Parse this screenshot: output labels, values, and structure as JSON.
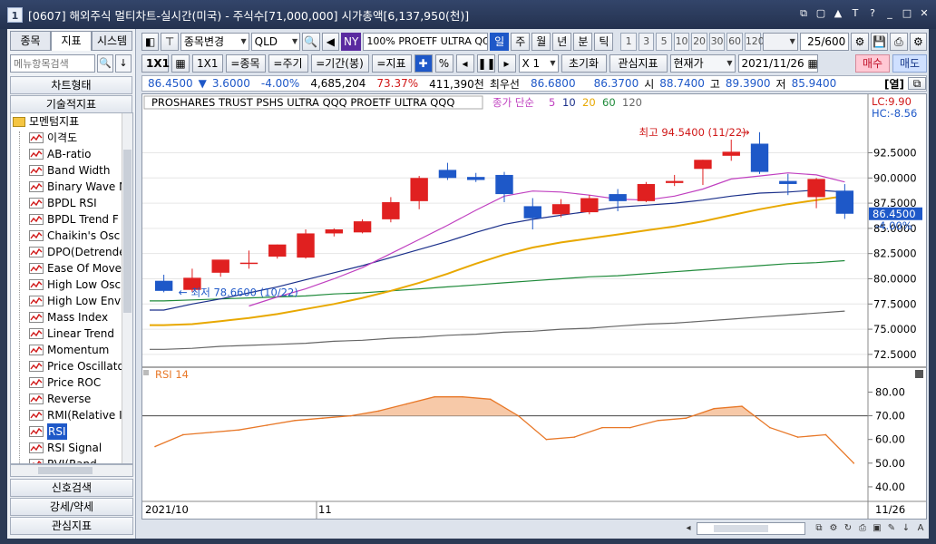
{
  "window": {
    "title": "[0607] 해외주식 멀티차트-실시간(미국) - 주식수[71,000,000] 시가총액[6,137,950(천)]",
    "app_icon_label": "1",
    "buttons": [
      "⧉",
      "▢",
      "▲",
      "T",
      "?",
      "_",
      "□",
      "✕"
    ]
  },
  "left_panel": {
    "tabs": [
      "종목",
      "지표",
      "시스템"
    ],
    "active_tab": "지표",
    "search_placeholder": "메뉴항목검색",
    "sections_top": [
      "차트형태",
      "기술적지표"
    ],
    "folder": "모멘텀지표",
    "items": [
      "이격도",
      "AB-ratio",
      "Band Width",
      "Binary Wave N",
      "BPDL RSI",
      "BPDL Trend F",
      "Chaikin's Osc",
      "DPO(Detrende",
      "Ease Of Move",
      "High Low Osc",
      "High Low Env",
      "Mass Index",
      "Linear Trend",
      "Momentum",
      "Price Oscillato",
      "Price ROC",
      "Reverse",
      "RMI(Relative I",
      "RSI",
      "RSI Signal",
      "RVI(Rand"
    ],
    "selected_item": "RSI",
    "sections_bottom": [
      "신호검색",
      "강세/약세",
      "관심지표"
    ]
  },
  "toolbar1": {
    "symbol_change": "종목변경",
    "ticker": "QLD",
    "market_badge": "NY",
    "zoom": "100%",
    "name": "PROETF ULTRA QQQ",
    "periods": [
      "일",
      "주",
      "월",
      "년",
      "분",
      "틱"
    ],
    "active_period": "일",
    "intervals": [
      "1",
      "3",
      "5",
      "10",
      "20",
      "30",
      "60",
      "120"
    ],
    "count": "25",
    "count_total": "/600"
  },
  "toolbar2": {
    "ratio": "1X1",
    "ratio2": "1X1",
    "btn_symbol": "=종목",
    "btn_period": "=주기",
    "btn_range": "=기간(봉)",
    "btn_indicator": "=지표",
    "multiplier": "X 1",
    "reset": "초기화",
    "fav_indicator": "관심지표",
    "price_mode": "현재가",
    "date": "2021/11/26",
    "buy": "매수",
    "sell": "매도"
  },
  "quote": {
    "price": "86.4500",
    "change_arrow": "▼",
    "change": "3.6000",
    "change_pct": "-4.00%",
    "volume": "4,685,204",
    "vol_ratio": "73.37%",
    "amount": "411,390천",
    "best_bid_label": "최우선",
    "bid": "86.6800",
    "ask": "86.3700",
    "open_label": "시",
    "open": "88.7400",
    "high_label": "고",
    "high": "89.3900",
    "low_label": "저",
    "low": "85.9400",
    "view_label": "[열]"
  },
  "chart_data": [
    {
      "type": "candlestick",
      "title": "PROSHARES TRUST PSHS ULTRA QQQ  PROETF ULTRA QQQ",
      "legend_label": "종가 단순",
      "ma_periods": [
        "5",
        "10",
        "20",
        "60",
        "120"
      ],
      "ma_colors": [
        "#c040c0",
        "#1a2f8a",
        "#e8a800",
        "#1f8a3a",
        "#666666"
      ],
      "up_color": "#e02020",
      "down_color": "#1e58c8",
      "candles": [
        {
          "o": 79.8,
          "h": 80.4,
          "l": 78.66,
          "c": 78.8
        },
        {
          "o": 78.9,
          "h": 81.0,
          "l": 78.7,
          "c": 80.1
        },
        {
          "o": 80.6,
          "h": 81.3,
          "l": 80.2,
          "c": 81.9
        },
        {
          "o": 81.5,
          "h": 82.8,
          "l": 81.0,
          "c": 81.6
        },
        {
          "o": 82.2,
          "h": 83.4,
          "l": 82.0,
          "c": 83.4
        },
        {
          "o": 82.1,
          "h": 84.9,
          "l": 82.0,
          "c": 84.5
        },
        {
          "o": 84.5,
          "h": 85.0,
          "l": 84.2,
          "c": 84.9
        },
        {
          "o": 84.6,
          "h": 85.9,
          "l": 84.5,
          "c": 85.7
        },
        {
          "o": 85.9,
          "h": 88.1,
          "l": 85.6,
          "c": 87.6
        },
        {
          "o": 87.7,
          "h": 90.2,
          "l": 86.9,
          "c": 90.0
        },
        {
          "o": 90.8,
          "h": 91.5,
          "l": 89.8,
          "c": 90.0
        },
        {
          "o": 90.1,
          "h": 90.5,
          "l": 89.6,
          "c": 89.8
        },
        {
          "o": 90.3,
          "h": 90.6,
          "l": 87.6,
          "c": 88.4
        },
        {
          "o": 87.2,
          "h": 88.0,
          "l": 84.9,
          "c": 86.0
        },
        {
          "o": 86.4,
          "h": 87.9,
          "l": 86.1,
          "c": 87.4
        },
        {
          "o": 86.6,
          "h": 88.3,
          "l": 86.4,
          "c": 88.0
        },
        {
          "o": 88.4,
          "h": 88.9,
          "l": 86.7,
          "c": 87.7
        },
        {
          "o": 87.7,
          "h": 89.6,
          "l": 87.6,
          "c": 89.4
        },
        {
          "o": 89.5,
          "h": 90.3,
          "l": 89.2,
          "c": 89.7
        },
        {
          "o": 90.9,
          "h": 91.8,
          "l": 89.3,
          "c": 91.8
        },
        {
          "o": 92.2,
          "h": 93.8,
          "l": 91.7,
          "c": 92.6
        },
        {
          "o": 93.4,
          "h": 94.54,
          "l": 90.4,
          "c": 90.6
        },
        {
          "o": 89.7,
          "h": 90.4,
          "l": 88.3,
          "c": 89.4
        },
        {
          "o": 88.1,
          "h": 90.0,
          "l": 87.0,
          "c": 89.9
        },
        {
          "o": 88.74,
          "h": 89.39,
          "l": 85.94,
          "c": 86.45
        }
      ],
      "ma5": [
        null,
        null,
        null,
        77.3,
        78.2,
        79.0,
        80.0,
        81.1,
        82.5,
        83.9,
        85.3,
        86.8,
        88.2,
        88.7,
        88.6,
        88.3,
        87.9,
        87.8,
        88.2,
        88.9,
        89.9,
        90.2,
        90.5,
        90.3,
        89.6
      ],
      "ma10": [
        76.9,
        77.5,
        78.0,
        78.6,
        79.2,
        79.9,
        80.6,
        81.3,
        82.1,
        82.9,
        83.7,
        84.6,
        85.4,
        85.9,
        86.3,
        86.7,
        87.1,
        87.3,
        87.5,
        87.8,
        88.2,
        88.5,
        88.6,
        88.8,
        88.6
      ],
      "ma20": [
        75.4,
        75.5,
        75.8,
        76.1,
        76.5,
        77.0,
        77.5,
        78.1,
        78.8,
        79.6,
        80.5,
        81.5,
        82.4,
        83.1,
        83.6,
        84.0,
        84.4,
        84.8,
        85.2,
        85.7,
        86.3,
        86.9,
        87.4,
        87.8,
        88.2
      ],
      "ma60": [
        77.8,
        77.9,
        78.0,
        78.1,
        78.2,
        78.3,
        78.5,
        78.6,
        78.8,
        79.0,
        79.2,
        79.4,
        79.6,
        79.8,
        80.0,
        80.2,
        80.3,
        80.5,
        80.7,
        80.9,
        81.1,
        81.3,
        81.5,
        81.6,
        81.8
      ],
      "ma120": [
        73.0,
        73.1,
        73.3,
        73.4,
        73.5,
        73.6,
        73.8,
        73.9,
        74.1,
        74.2,
        74.4,
        74.5,
        74.7,
        74.8,
        75.0,
        75.1,
        75.3,
        75.5,
        75.6,
        75.8,
        76.0,
        76.2,
        76.4,
        76.6,
        76.8
      ],
      "ylim": [
        71.5,
        96.5
      ],
      "yticks": [
        "92.5000",
        "90.0000",
        "87.5000",
        "85.0000",
        "82.5000",
        "80.0000",
        "77.5000",
        "75.0000",
        "72.5000"
      ],
      "high_annotation": "최고 94.5400 (11/22)",
      "low_annotation": "최저 78.6600 (10/22)",
      "current_price_label": "86.4500",
      "current_pct_label": "-4.00%",
      "lc_label": "LC:9.90",
      "hc_label": "HC:-8.56"
    },
    {
      "type": "line",
      "title": "RSI 14",
      "color": "#e87828",
      "values": [
        57,
        62,
        63,
        64,
        66,
        68,
        69,
        70,
        72,
        75,
        78,
        78,
        77,
        70,
        60,
        61,
        65,
        65,
        68,
        69,
        73,
        74,
        65,
        61,
        62,
        50
      ],
      "ylim": [
        35,
        84
      ],
      "yticks": [
        "80.00",
        "70.00",
        "60.00",
        "50.00",
        "40.00"
      ],
      "threshold": 70
    }
  ],
  "x_axis": {
    "labels": [
      "2021/10",
      "11"
    ],
    "end_label": "11/26"
  }
}
